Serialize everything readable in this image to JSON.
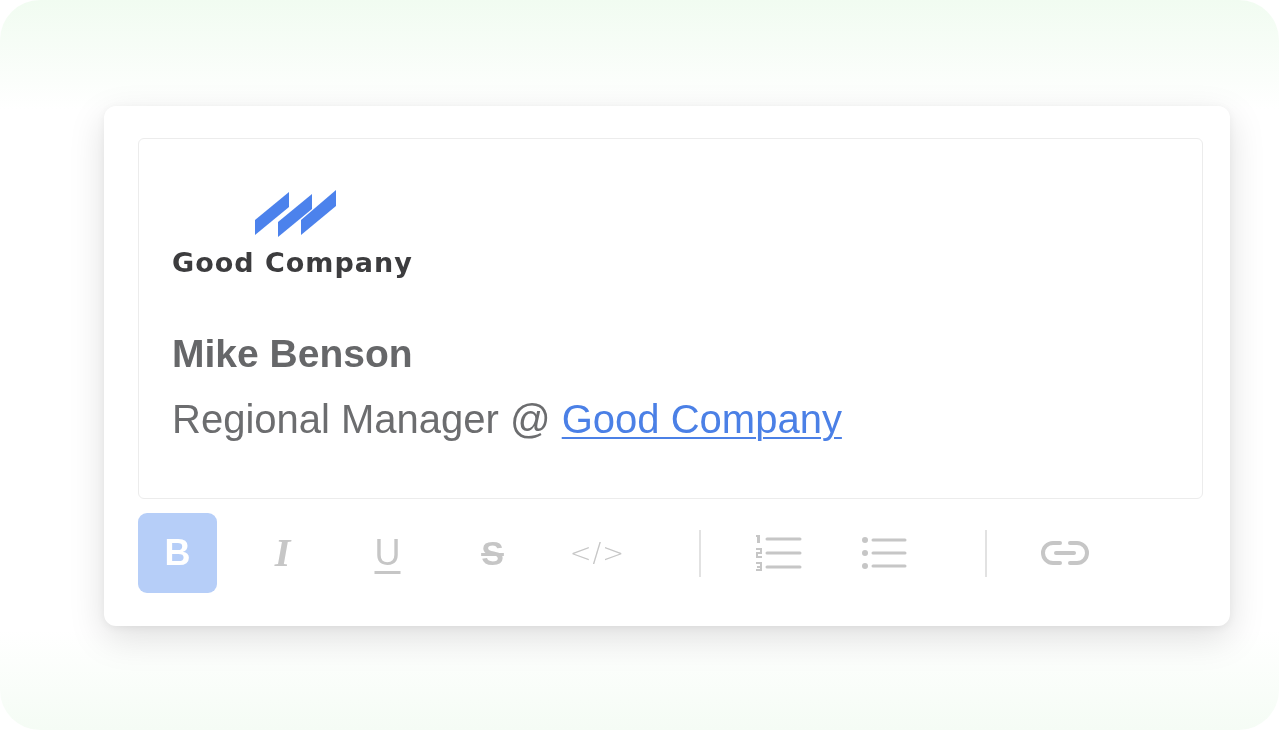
{
  "logo": {
    "text": "Good Company"
  },
  "signature": {
    "name": "Mike Benson",
    "role": "Regional Manager @",
    "link": "Good Company"
  },
  "toolbar": [
    {
      "kind": "bold",
      "label": "B",
      "selected": true
    },
    {
      "kind": "italic",
      "label": "I",
      "selected": false
    },
    {
      "kind": "underline",
      "label": "U",
      "selected": false
    },
    {
      "kind": "strike",
      "label": "S",
      "selected": false
    },
    {
      "kind": "code",
      "label": "</>",
      "selected": false
    },
    {
      "kind": "divider"
    },
    {
      "kind": "numbered",
      "selected": false
    },
    {
      "kind": "bulleted",
      "selected": false
    },
    {
      "kind": "divider"
    },
    {
      "kind": "link",
      "selected": false
    }
  ]
}
